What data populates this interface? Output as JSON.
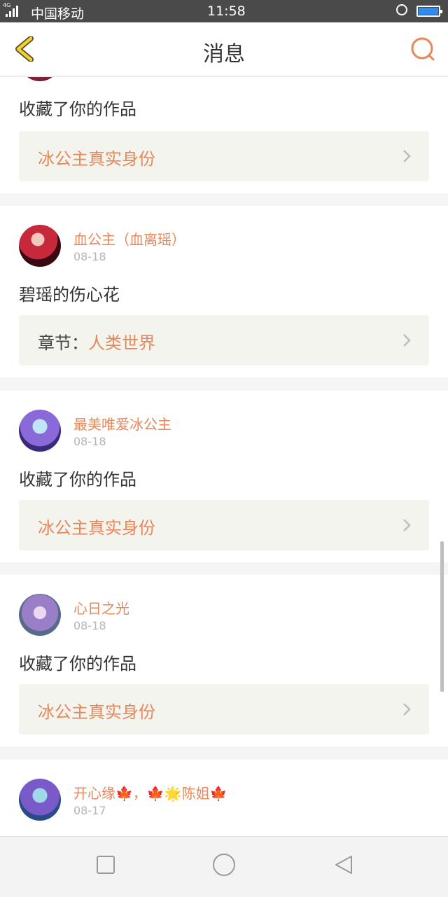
{
  "statusbar": {
    "network": "4G",
    "carrier": "中国移动",
    "time": "11:58"
  },
  "header": {
    "title": "消息",
    "back_icon": "chevron-left-icon",
    "search_icon": "search-icon"
  },
  "colors": {
    "accent": "#e8875a",
    "ref_bg": "#f4f4ef",
    "back_icon": "#f0cf3a",
    "battery": "#2e8cf0"
  },
  "messages": [
    {
      "message": "收藏了你的作品",
      "ref_title": "冰公主真实身份"
    },
    {
      "user": "血公主（血离瑶）",
      "date": "08-18",
      "message": "碧瑶的伤心花",
      "ref_prefix": "章节：",
      "ref_title": "人类世界"
    },
    {
      "user": "最美唯爱冰公主",
      "date": "08-18",
      "message": "收藏了你的作品",
      "ref_title": "冰公主真实身份"
    },
    {
      "user": "心日之光",
      "date": "08-18",
      "message": "收藏了你的作品",
      "ref_title": "冰公主真实身份"
    },
    {
      "user": "开心缘🍁，🍁🌟陈姐🍁",
      "date": "08-17"
    }
  ],
  "navbar": {
    "icons": [
      "square-icon",
      "circle-icon",
      "triangle-back-icon"
    ]
  }
}
